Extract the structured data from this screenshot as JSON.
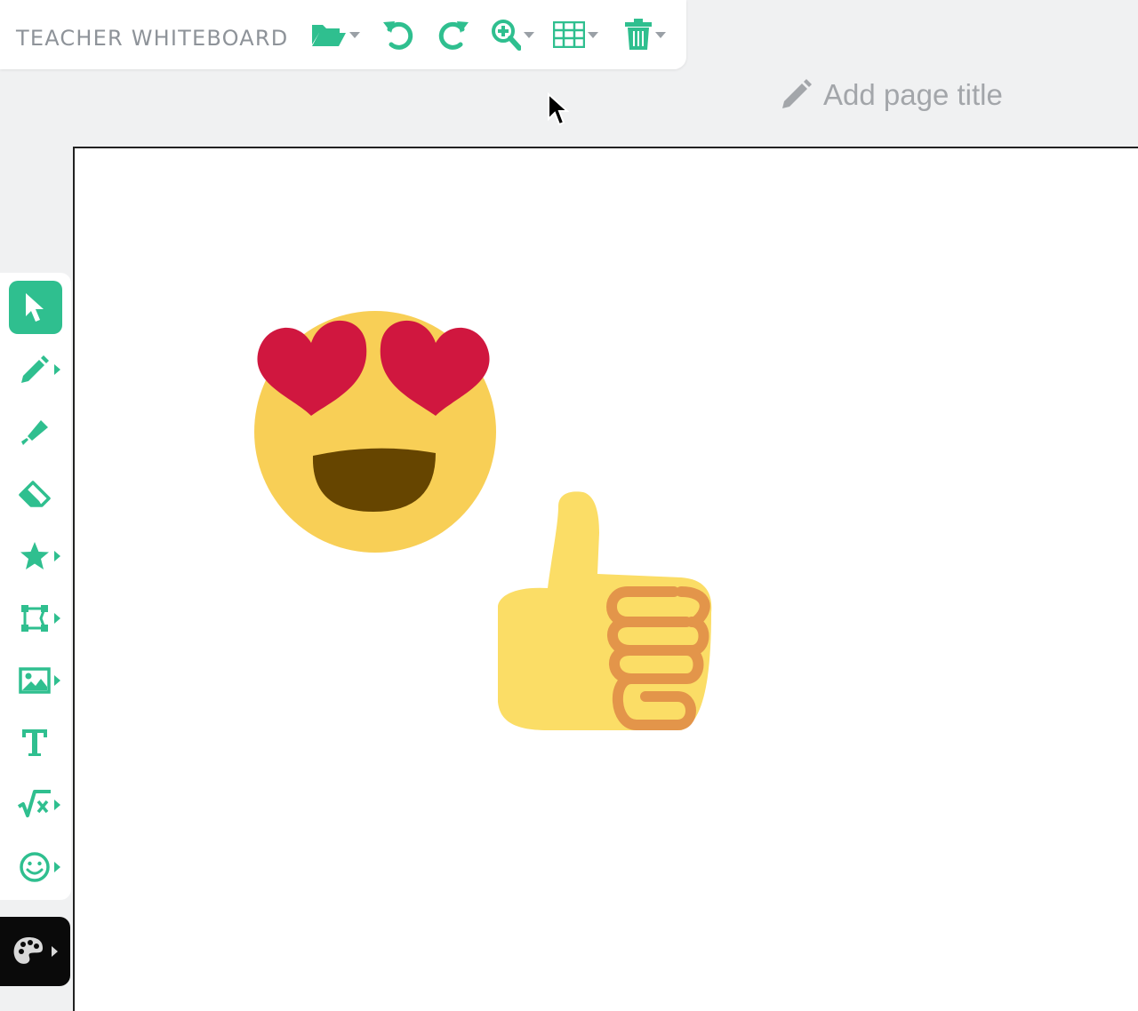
{
  "app": {
    "title": "TEACHER WHITEBOARD"
  },
  "toolbar": {
    "buttons": [
      {
        "name": "open-file",
        "icon": "folder-open-icon",
        "has_dropdown": true
      },
      {
        "name": "undo",
        "icon": "undo-icon",
        "has_dropdown": false
      },
      {
        "name": "redo",
        "icon": "redo-icon",
        "has_dropdown": false
      },
      {
        "name": "zoom",
        "icon": "zoom-in-icon",
        "has_dropdown": true
      },
      {
        "name": "grid",
        "icon": "grid-icon",
        "has_dropdown": true
      },
      {
        "name": "delete",
        "icon": "trash-icon",
        "has_dropdown": true
      }
    ]
  },
  "page": {
    "title_placeholder": "Add page title",
    "title_icon": "pencil-icon"
  },
  "sidebar": {
    "tools": [
      {
        "name": "select",
        "icon": "pointer-icon",
        "active": true,
        "has_submenu": false
      },
      {
        "name": "pen",
        "icon": "pencil-icon",
        "active": false,
        "has_submenu": true
      },
      {
        "name": "highlighter",
        "icon": "highlighter-icon",
        "active": false,
        "has_submenu": false
      },
      {
        "name": "eraser",
        "icon": "eraser-icon",
        "active": false,
        "has_submenu": false
      },
      {
        "name": "stamp",
        "icon": "star-icon",
        "active": false,
        "has_submenu": true
      },
      {
        "name": "shapes",
        "icon": "shape-icon",
        "active": false,
        "has_submenu": true
      },
      {
        "name": "image",
        "icon": "image-icon",
        "active": false,
        "has_submenu": true
      },
      {
        "name": "text",
        "icon": "text-icon",
        "active": false,
        "has_submenu": false
      },
      {
        "name": "math",
        "icon": "square-root-icon",
        "active": false,
        "has_submenu": true
      },
      {
        "name": "emoji",
        "icon": "smiley-icon",
        "active": false,
        "has_submenu": true
      }
    ],
    "palette": {
      "icon": "palette-icon",
      "has_submenu": true
    }
  },
  "canvas": {
    "items": [
      {
        "type": "emoji",
        "name": "heart-eyes-emoji"
      },
      {
        "type": "emoji",
        "name": "thumbs-up-emoji"
      }
    ]
  },
  "colors": {
    "accent": "#2fbf8f",
    "background": "#f0f1f2",
    "canvas": "#ffffff",
    "title_text": "#8e9399",
    "placeholder_text": "#a3a6aa",
    "palette_bg": "#0a0a0a"
  }
}
